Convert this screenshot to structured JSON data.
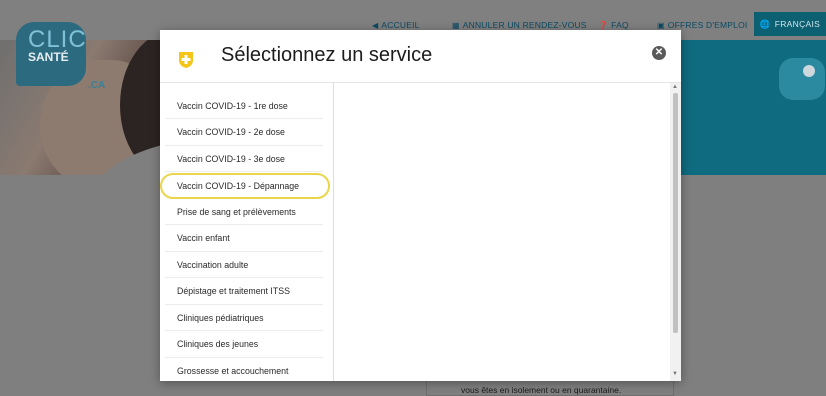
{
  "nav": {
    "home": "ACCUEIL",
    "cancel": "ANNULER UN RENDEZ-VOUS",
    "faq": "FAQ",
    "jobs": "OFFRES D'EMPLOI",
    "language": "FRANÇAIS"
  },
  "logo": {
    "line1": "CLIC",
    "line2": "SANTÉ",
    "suffix": ".CA"
  },
  "background_notice": "vous êtes en isolement ou en quarantaine.",
  "modal": {
    "title": "Sélectionnez un service",
    "close_icon": "close-circle-icon",
    "services": [
      {
        "label": "Vaccin COVID-19 - 1re dose"
      },
      {
        "label": "Vaccin COVID-19 - 2e dose"
      },
      {
        "label": "Vaccin COVID-19 - 3e dose"
      },
      {
        "label": "Vaccin COVID-19 - Dépannage"
      },
      {
        "label": "Prise de sang et prélèvements"
      },
      {
        "label": "Vaccin enfant"
      },
      {
        "label": "Vaccination adulte"
      },
      {
        "label": "Dépistage et traitement ITSS"
      },
      {
        "label": "Cliniques pédiatriques"
      },
      {
        "label": "Cliniques des jeunes"
      },
      {
        "label": "Grossesse et accouchement"
      }
    ],
    "highlighted_index": 3
  },
  "colors": {
    "accent_teal": "#0d5f72",
    "highlight_ring": "#ead64a",
    "icon_yellow": "#f5c518"
  }
}
